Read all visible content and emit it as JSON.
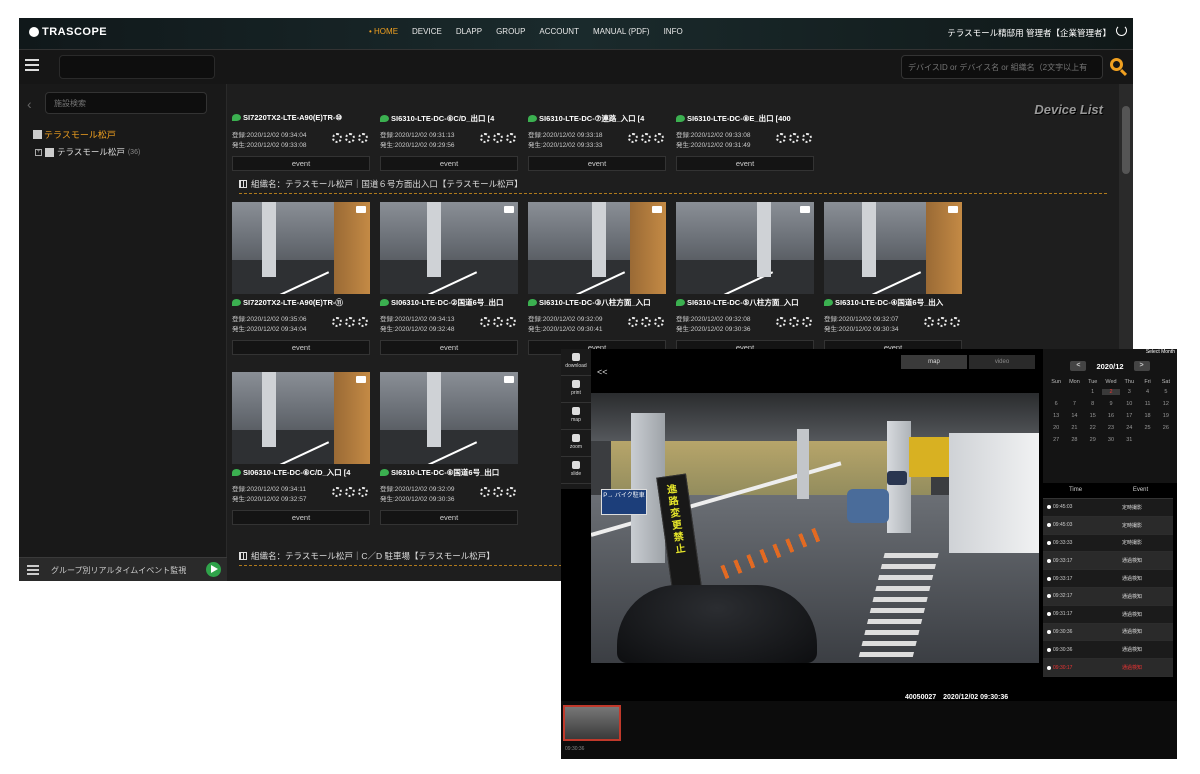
{
  "app": {
    "logo": "TRASCOPE",
    "user": "テラスモール精邸用 管理者【企業管理者】"
  },
  "nav": [
    "HOME",
    "DEVICE",
    "DLAPP",
    "GROUP",
    "ACCOUNT",
    "MANUAL (PDF)",
    "INFO"
  ],
  "nav_active": "HOME",
  "toolbar": {
    "device_search_placeholder": "デバイスID or デバイス名 or 組織名（2文字以上有"
  },
  "sidebar": {
    "search_placeholder": "施設検索",
    "tree_root": "テラスモール松戸",
    "tree_child": "テラスモール松戸",
    "tree_child_count": "(36)",
    "footer_label": "グループ別リアルタイムイベント監視"
  },
  "content": {
    "title": "Device List",
    "row1": [
      {
        "name": "SI7220TX2-LTE-A90(E)TR-⑩",
        "reg": "登録:2020/12/02 09:34:04",
        "occ": "発生:2020/12/02 09:33:08",
        "event": "event"
      },
      {
        "name": "SI6310-LTE-DC-⑥C/D_出口 [4",
        "reg": "登録:2020/12/02 09:31:13",
        "occ": "発生:2020/12/02 09:29:56",
        "event": "event"
      },
      {
        "name": "SI6310-LTE-DC-⑦連路_入口 [4",
        "reg": "登録:2020/12/02 09:33:18",
        "occ": "発生:2020/12/02 09:33:33",
        "event": "event"
      },
      {
        "name": "SI6310-LTE-DC-⑧E_出口 [400",
        "reg": "登録:2020/12/02 09:33:08",
        "occ": "発生:2020/12/02 09:31:49",
        "event": "event"
      }
    ],
    "group2": "組織名：テラスモール松戸｜国道６号方面出入口【テラスモール松戸】",
    "row2": [
      {
        "name": "SI7220TX2-LTE-A90(E)TR-⑪",
        "reg": "登録:2020/12/02 09:35:06",
        "occ": "発生:2020/12/02 09:34:04",
        "event": "event"
      },
      {
        "name": "SI06310-LTE-DC-②国道6号_出口",
        "reg": "登録:2020/12/02 09:34:13",
        "occ": "発生:2020/12/02 09:32:48",
        "event": "event"
      },
      {
        "name": "SI6310-LTE-DC-③八柱方面_入口",
        "reg": "登録:2020/12/02 09:32:09",
        "occ": "発生:2020/12/02 09:30:41",
        "event": "event"
      },
      {
        "name": "SI6310-LTE-DC-⑤八柱方面_入口",
        "reg": "登録:2020/12/02 09:32:08",
        "occ": "発生:2020/12/02 09:30:36",
        "event": "event"
      },
      {
        "name": "SI6310-LTE-DC-④国道6号_出入",
        "reg": "登録:2020/12/02 09:32:07",
        "occ": "発生:2020/12/02 09:30:34",
        "event": "event"
      }
    ],
    "row3": [
      {
        "name": "SI06310-LTE-DC-⑥C/D_入口 [4",
        "reg": "登録:2020/12/02 09:34:11",
        "occ": "発生:2020/12/02 09:32:57",
        "event": "event"
      },
      {
        "name": "SI6310-LTE-DC-⑥国道6号_出口",
        "reg": "登録:2020/12/02 09:32:09",
        "occ": "発生:2020/12/02 09:30:36",
        "event": "event"
      }
    ],
    "group3": "組織名：テラスモール松戸｜C／D 駐車場【テラスモール松戸】"
  },
  "player": {
    "tools": [
      "download",
      "print",
      "map",
      "zoom",
      "slide"
    ],
    "collapse": "<<",
    "tabs": [
      "map",
      "video"
    ],
    "sign_text": "進路変更禁止",
    "blue_sign": "P→ バイク駐車",
    "caption": "40050027　2020/12/02 09:30:36",
    "thumb_label": "09:30:36",
    "calendar": {
      "corner": "Select Month",
      "prev": "<",
      "next": ">",
      "month": "2020/12",
      "weekdays": [
        "Sun",
        "Mon",
        "Tue",
        "Wed",
        "Thu",
        "Fri",
        "Sat"
      ],
      "days": [
        "",
        "",
        "1",
        "2",
        "3",
        "4",
        "5",
        "6",
        "7",
        "8",
        "9",
        "10",
        "11",
        "12",
        "13",
        "14",
        "15",
        "16",
        "17",
        "18",
        "19",
        "20",
        "21",
        "22",
        "23",
        "24",
        "25",
        "26",
        "27",
        "28",
        "29",
        "30",
        "31",
        "",
        ""
      ],
      "selected": "2"
    },
    "events": {
      "headers": [
        "Time",
        "Event"
      ],
      "rows": [
        {
          "time": "09:45:03",
          "event": "定時撮影"
        },
        {
          "time": "09:45:03",
          "event": "定時撮影"
        },
        {
          "time": "09:33:33",
          "event": "定時撮影"
        },
        {
          "time": "09:33:17",
          "event": "通過検知"
        },
        {
          "time": "09:33:17",
          "event": "通過検知"
        },
        {
          "time": "09:32:17",
          "event": "通過検知"
        },
        {
          "time": "09:31:17",
          "event": "通過検知"
        },
        {
          "time": "09:30:36",
          "event": "通過検知"
        },
        {
          "time": "09:30:36",
          "event": "通過検知"
        },
        {
          "time": "09:30:17",
          "event": "通過検知",
          "alert": true
        }
      ]
    }
  }
}
